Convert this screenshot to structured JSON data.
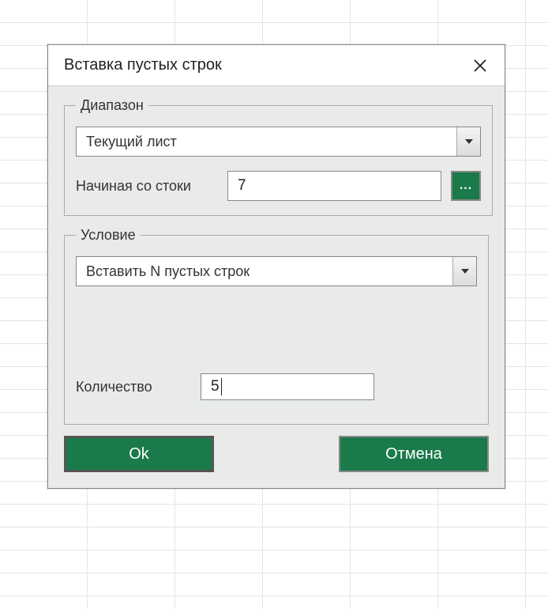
{
  "dialog": {
    "title": "Вставка пустых строк",
    "close_label": "Close"
  },
  "range": {
    "legend": "Диапазон",
    "scope_selected": "Текущий лист",
    "start_row_label": "Начиная со стоки",
    "start_row_value": "7",
    "pick_label": "..."
  },
  "condition": {
    "legend": "Условие",
    "selected": "Вставить N пустых строк",
    "qty_label": "Количество",
    "qty_value": "5"
  },
  "buttons": {
    "ok": "Ok",
    "cancel": "Отмена"
  },
  "colors": {
    "accent": "#1a7a4a"
  }
}
